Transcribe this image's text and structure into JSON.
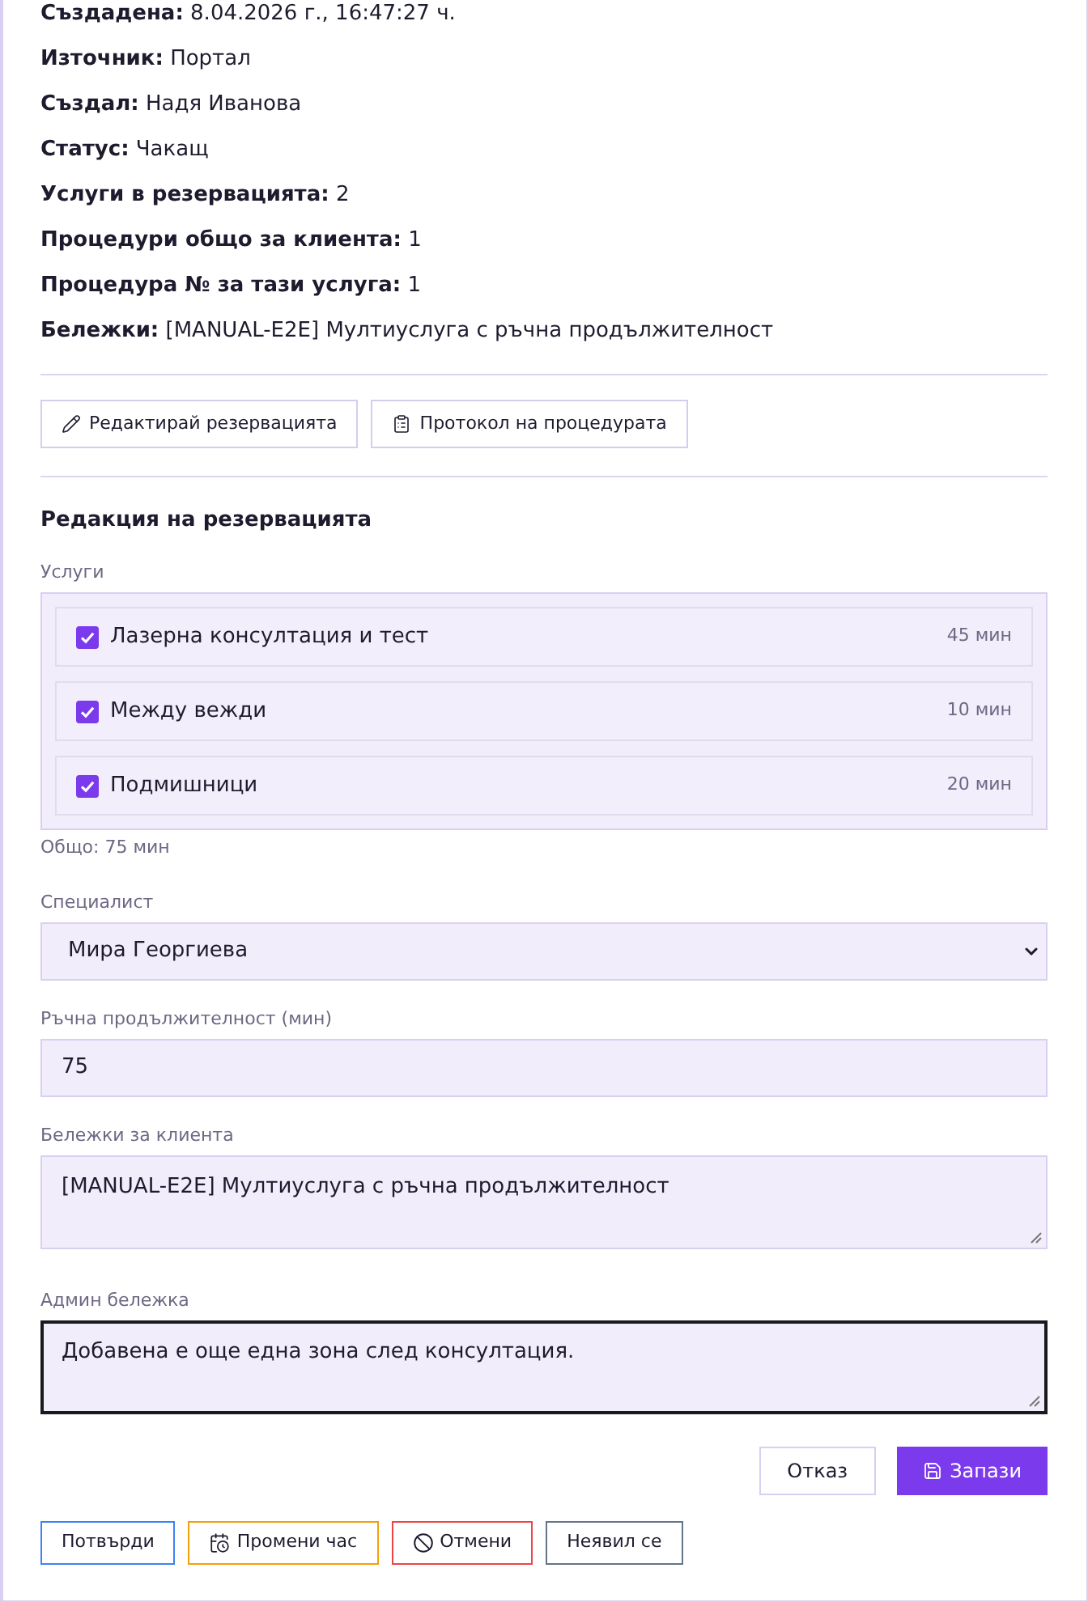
{
  "details": [
    "**Създадена:** 8.04.2026 г., 16:47:27 ч.",
    "**Източник:** Портал",
    "**Създал:** Надя Иванова",
    "**Статус:** Чакащ",
    "**Услуги в резервацията:** 2",
    "**Процедури общо за клиента:** 1",
    "**Процедура № за тази услуга:** 1",
    "**Бележки:** [MANUAL-E2E] Мултиуслуга с ръчна продължителност"
  ],
  "actions": [
    {
      "kind": "edit",
      "label": "Редактирай резервацията"
    },
    {
      "kind": "protocol",
      "label": "Протокол на процедурата"
    }
  ],
  "edit_form": {
    "title": "Редакция на резервацията",
    "services_label": "Услуги",
    "services": [
      {
        "name": "Лазерна консултация и тест",
        "duration": "45 мин",
        "checked": true
      },
      {
        "name": "Между вежди",
        "duration": "10 мин",
        "checked": true
      },
      {
        "name": "Подмишници",
        "duration": "20 мин",
        "checked": true
      }
    ],
    "total": "Общо: 75 мин",
    "specialist": {
      "label": "Специалист",
      "value": "Мира Георгиева"
    },
    "manual_duration": {
      "label": "Ръчна продължителност (мин)",
      "value": "75"
    },
    "client_notes": {
      "label": "Бележки за клиента",
      "value": "[MANUAL-E2E] Мултиуслуга с ръчна продължителност",
      "focused": false
    },
    "admin_note": {
      "label": "Админ бележка",
      "value": "Добавена е още една зона след консултация.",
      "focused": true
    },
    "buttons": [
      {
        "kind": "secondary",
        "label": "Отказ"
      },
      {
        "kind": "primary",
        "label": "Запази"
      }
    ]
  },
  "status_buttons": [
    {
      "kind": "confirm",
      "label": "Потвърди",
      "color": "#3b82f6"
    },
    {
      "kind": "reschedule",
      "label": "Промени час",
      "color": "#f59e0b"
    },
    {
      "kind": "cancel",
      "label": "Отмени",
      "color": "#ef4444"
    },
    {
      "kind": "no_show",
      "label": "Неявил се",
      "color": "#64748b"
    }
  ]
}
